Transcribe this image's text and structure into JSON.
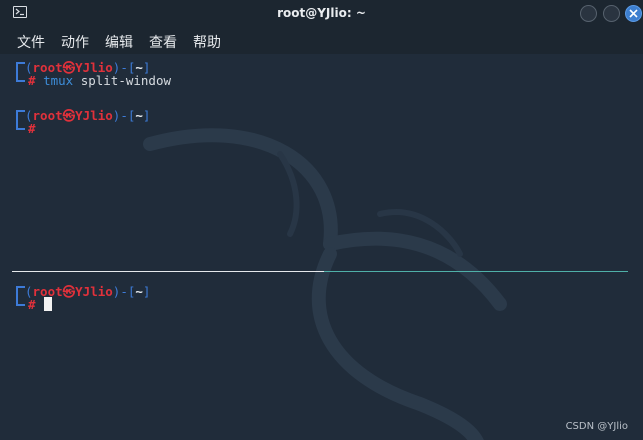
{
  "window": {
    "title": "root@YJlio: ~"
  },
  "menu": {
    "items": [
      "文件",
      "动作",
      "编辑",
      "查看",
      "帮助"
    ]
  },
  "prompt": {
    "user": "root",
    "separator": "㉿",
    "host": "YJlio",
    "path": "~",
    "symbol": "#"
  },
  "top_pane": {
    "command_name": "tmux",
    "command_args": " split-window"
  },
  "colors": {
    "background": "#202c3a",
    "prompt_red": "#e0313b",
    "prompt_blue": "#3d7bd8",
    "active_pane_border": "#4fb0a8"
  },
  "watermark": "CSDN @YJlio"
}
